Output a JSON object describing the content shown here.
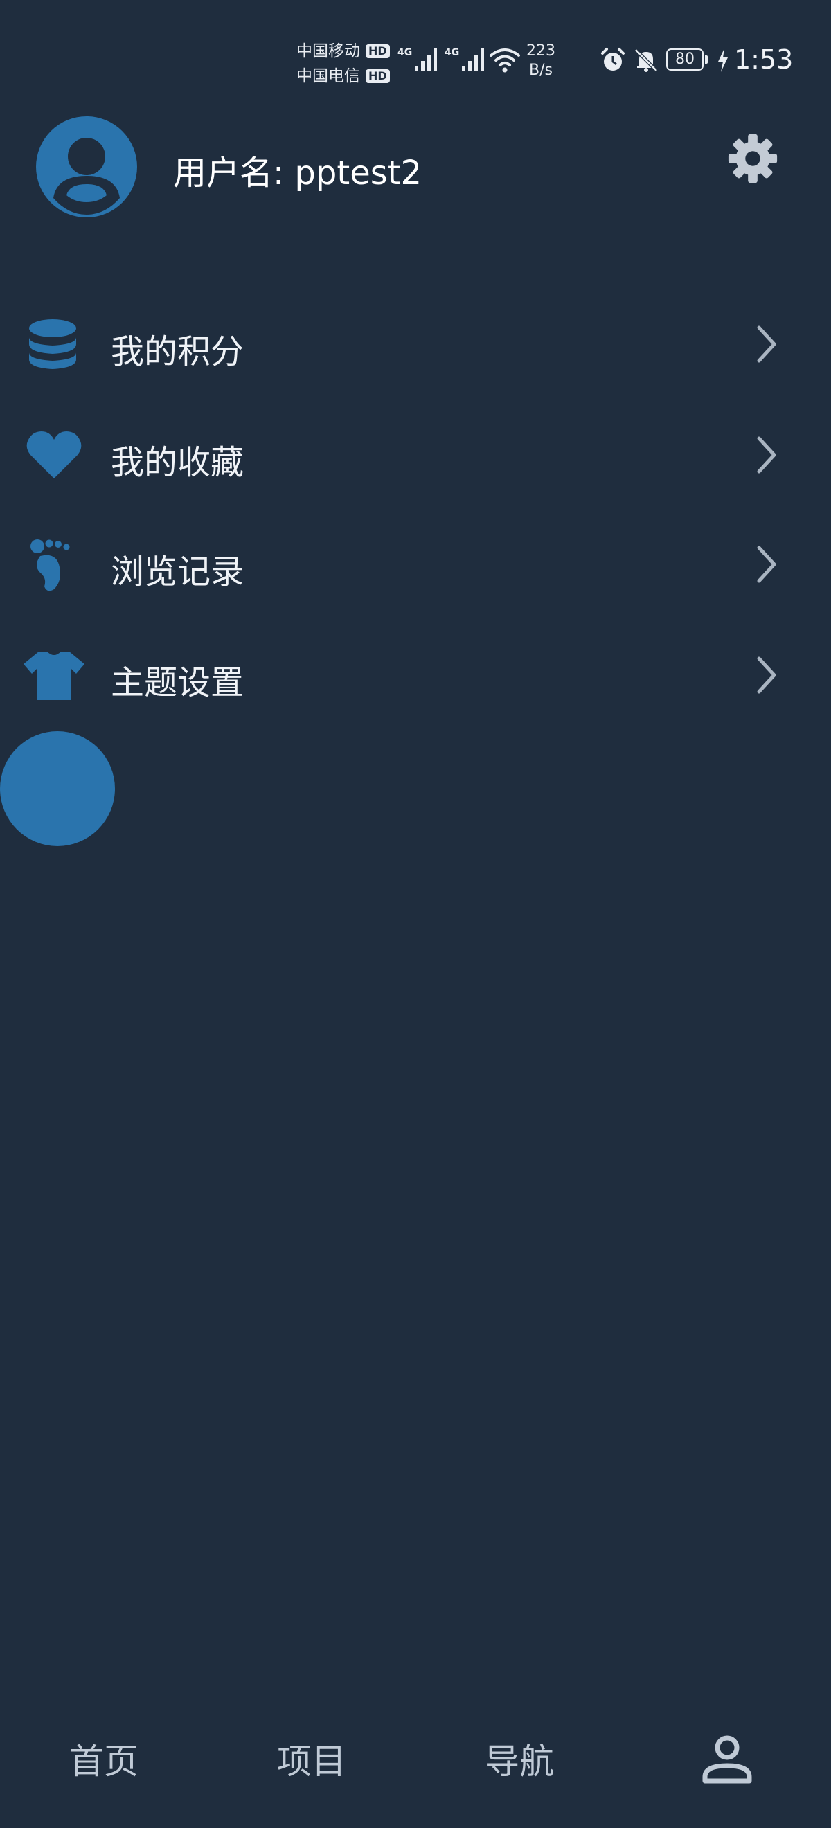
{
  "status_bar": {
    "carrier_1": "中国移动",
    "carrier_2": "中国电信",
    "hd_badge": "HD",
    "network_type_1": "4G",
    "network_type_2": "4G",
    "speed_value": "223",
    "speed_unit": "B/s",
    "battery_level": "80",
    "time": "1:53"
  },
  "profile": {
    "username_label": "用户名: pptest2"
  },
  "menu": {
    "items": [
      {
        "label": "我的积分",
        "icon": "coin-stack-icon"
      },
      {
        "label": "我的收藏",
        "icon": "heart-icon"
      },
      {
        "label": "浏览记录",
        "icon": "footprint-icon"
      },
      {
        "label": "主题设置",
        "icon": "tshirt-icon"
      }
    ]
  },
  "bottom_nav": {
    "tabs": [
      {
        "label": "首页"
      },
      {
        "label": "项目"
      },
      {
        "label": "导航"
      },
      {
        "label": "",
        "icon": "person-icon",
        "active": true
      }
    ]
  },
  "colors": {
    "background": "#1f2d3e",
    "accent": "#2a74ad",
    "text": "#f0f3f7",
    "muted": "#c0cad6"
  }
}
